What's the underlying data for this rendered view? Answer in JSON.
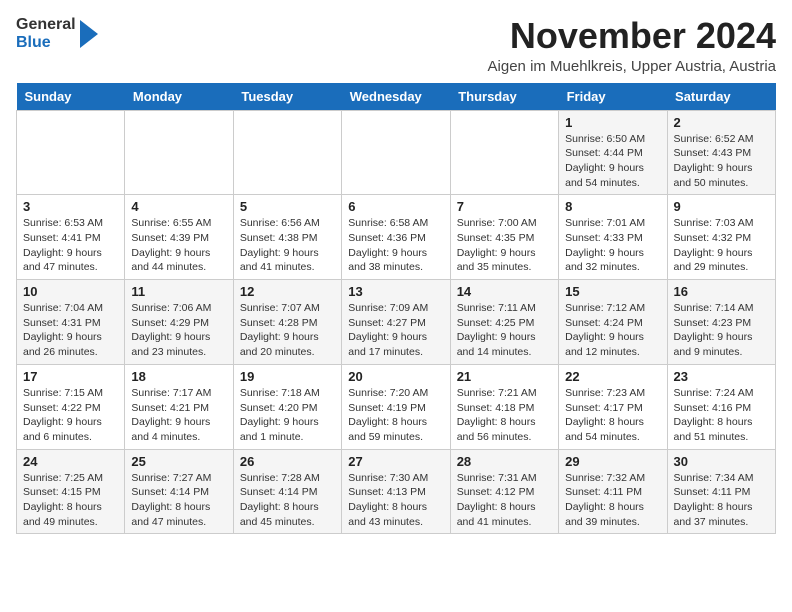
{
  "header": {
    "logo_general": "General",
    "logo_blue": "Blue",
    "title": "November 2024",
    "subtitle": "Aigen im Muehlkreis, Upper Austria, Austria"
  },
  "weekdays": [
    "Sunday",
    "Monday",
    "Tuesday",
    "Wednesday",
    "Thursday",
    "Friday",
    "Saturday"
  ],
  "weeks": [
    [
      {
        "day": "",
        "info": ""
      },
      {
        "day": "",
        "info": ""
      },
      {
        "day": "",
        "info": ""
      },
      {
        "day": "",
        "info": ""
      },
      {
        "day": "",
        "info": ""
      },
      {
        "day": "1",
        "info": "Sunrise: 6:50 AM\nSunset: 4:44 PM\nDaylight: 9 hours and 54 minutes."
      },
      {
        "day": "2",
        "info": "Sunrise: 6:52 AM\nSunset: 4:43 PM\nDaylight: 9 hours and 50 minutes."
      }
    ],
    [
      {
        "day": "3",
        "info": "Sunrise: 6:53 AM\nSunset: 4:41 PM\nDaylight: 9 hours and 47 minutes."
      },
      {
        "day": "4",
        "info": "Sunrise: 6:55 AM\nSunset: 4:39 PM\nDaylight: 9 hours and 44 minutes."
      },
      {
        "day": "5",
        "info": "Sunrise: 6:56 AM\nSunset: 4:38 PM\nDaylight: 9 hours and 41 minutes."
      },
      {
        "day": "6",
        "info": "Sunrise: 6:58 AM\nSunset: 4:36 PM\nDaylight: 9 hours and 38 minutes."
      },
      {
        "day": "7",
        "info": "Sunrise: 7:00 AM\nSunset: 4:35 PM\nDaylight: 9 hours and 35 minutes."
      },
      {
        "day": "8",
        "info": "Sunrise: 7:01 AM\nSunset: 4:33 PM\nDaylight: 9 hours and 32 minutes."
      },
      {
        "day": "9",
        "info": "Sunrise: 7:03 AM\nSunset: 4:32 PM\nDaylight: 9 hours and 29 minutes."
      }
    ],
    [
      {
        "day": "10",
        "info": "Sunrise: 7:04 AM\nSunset: 4:31 PM\nDaylight: 9 hours and 26 minutes."
      },
      {
        "day": "11",
        "info": "Sunrise: 7:06 AM\nSunset: 4:29 PM\nDaylight: 9 hours and 23 minutes."
      },
      {
        "day": "12",
        "info": "Sunrise: 7:07 AM\nSunset: 4:28 PM\nDaylight: 9 hours and 20 minutes."
      },
      {
        "day": "13",
        "info": "Sunrise: 7:09 AM\nSunset: 4:27 PM\nDaylight: 9 hours and 17 minutes."
      },
      {
        "day": "14",
        "info": "Sunrise: 7:11 AM\nSunset: 4:25 PM\nDaylight: 9 hours and 14 minutes."
      },
      {
        "day": "15",
        "info": "Sunrise: 7:12 AM\nSunset: 4:24 PM\nDaylight: 9 hours and 12 minutes."
      },
      {
        "day": "16",
        "info": "Sunrise: 7:14 AM\nSunset: 4:23 PM\nDaylight: 9 hours and 9 minutes."
      }
    ],
    [
      {
        "day": "17",
        "info": "Sunrise: 7:15 AM\nSunset: 4:22 PM\nDaylight: 9 hours and 6 minutes."
      },
      {
        "day": "18",
        "info": "Sunrise: 7:17 AM\nSunset: 4:21 PM\nDaylight: 9 hours and 4 minutes."
      },
      {
        "day": "19",
        "info": "Sunrise: 7:18 AM\nSunset: 4:20 PM\nDaylight: 9 hours and 1 minute."
      },
      {
        "day": "20",
        "info": "Sunrise: 7:20 AM\nSunset: 4:19 PM\nDaylight: 8 hours and 59 minutes."
      },
      {
        "day": "21",
        "info": "Sunrise: 7:21 AM\nSunset: 4:18 PM\nDaylight: 8 hours and 56 minutes."
      },
      {
        "day": "22",
        "info": "Sunrise: 7:23 AM\nSunset: 4:17 PM\nDaylight: 8 hours and 54 minutes."
      },
      {
        "day": "23",
        "info": "Sunrise: 7:24 AM\nSunset: 4:16 PM\nDaylight: 8 hours and 51 minutes."
      }
    ],
    [
      {
        "day": "24",
        "info": "Sunrise: 7:25 AM\nSunset: 4:15 PM\nDaylight: 8 hours and 49 minutes."
      },
      {
        "day": "25",
        "info": "Sunrise: 7:27 AM\nSunset: 4:14 PM\nDaylight: 8 hours and 47 minutes."
      },
      {
        "day": "26",
        "info": "Sunrise: 7:28 AM\nSunset: 4:14 PM\nDaylight: 8 hours and 45 minutes."
      },
      {
        "day": "27",
        "info": "Sunrise: 7:30 AM\nSunset: 4:13 PM\nDaylight: 8 hours and 43 minutes."
      },
      {
        "day": "28",
        "info": "Sunrise: 7:31 AM\nSunset: 4:12 PM\nDaylight: 8 hours and 41 minutes."
      },
      {
        "day": "29",
        "info": "Sunrise: 7:32 AM\nSunset: 4:11 PM\nDaylight: 8 hours and 39 minutes."
      },
      {
        "day": "30",
        "info": "Sunrise: 7:34 AM\nSunset: 4:11 PM\nDaylight: 8 hours and 37 minutes."
      }
    ]
  ]
}
